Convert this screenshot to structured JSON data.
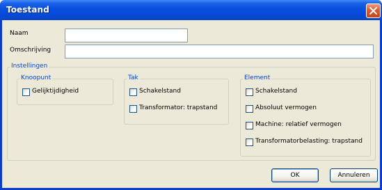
{
  "window": {
    "title": "Toestand"
  },
  "fields": {
    "naam_label": "Naam",
    "naam_value": "",
    "omschrijving_label": "Omschrijving",
    "omschrijving_value": ""
  },
  "instellingen": {
    "title": "Instellingen",
    "knooppunt": {
      "title": "Knoopunt",
      "options": [
        {
          "label": "Gelijktijdigheid",
          "checked": false
        }
      ]
    },
    "tak": {
      "title": "Tak",
      "options": [
        {
          "label": "Schakelstand",
          "checked": false
        },
        {
          "label": "Transformator: trapstand",
          "checked": false
        }
      ]
    },
    "element": {
      "title": "Element",
      "options": [
        {
          "label": "Schakelstand",
          "checked": false
        },
        {
          "label": "Absoluut vermogen",
          "checked": false
        },
        {
          "label": "Machine: relatief vermogen",
          "checked": false
        },
        {
          "label": "Transformatorbelasting: trapstand",
          "checked": false
        }
      ]
    }
  },
  "buttons": {
    "ok": "OK",
    "cancel": "Annuleren"
  }
}
